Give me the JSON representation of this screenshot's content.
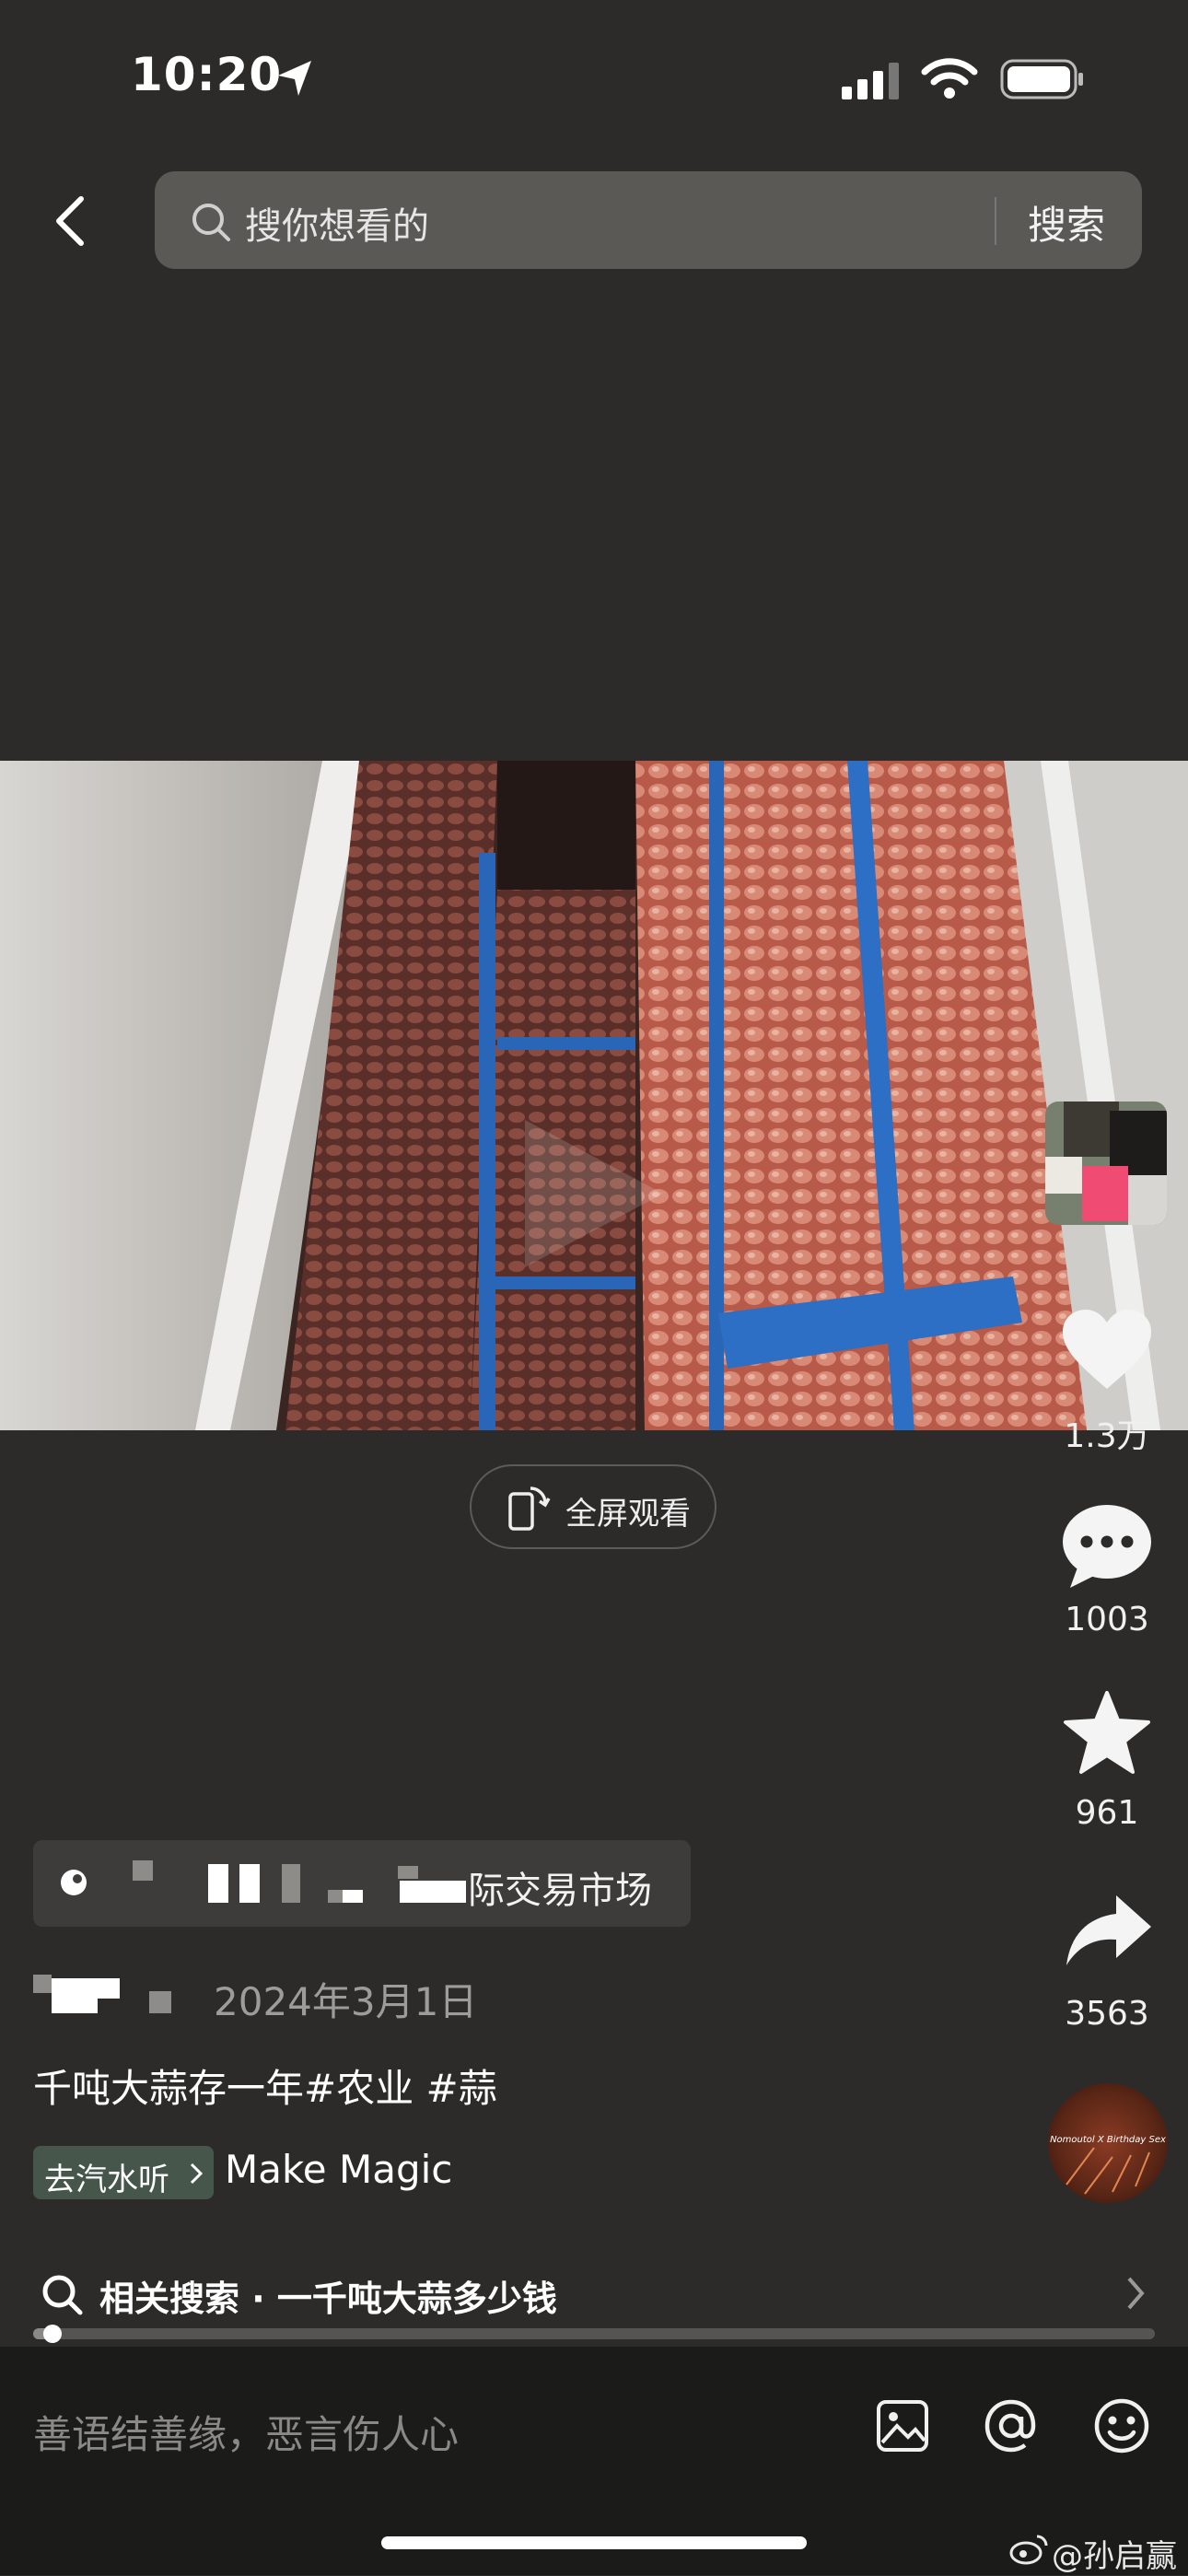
{
  "status_bar": {
    "time": "10:20"
  },
  "search": {
    "placeholder": "搜你想看的",
    "button_label": "搜索"
  },
  "video": {
    "fullscreen_label": "全屏观看"
  },
  "rail": {
    "like_count": "1.3万",
    "comment_count": "1003",
    "favorite_count": "961",
    "share_count": "3563",
    "music_disc_text": "Nomoutol X Birthday Sex"
  },
  "post": {
    "poi_label": "际交易市场",
    "date": "2024年3月1日",
    "caption": "千吨大蒜存一年#农业 #蒜",
    "music_badge": "去汽水听",
    "music_name": "Make Magic"
  },
  "related": {
    "label": "相关搜索 · 一千吨大蒜多少钱"
  },
  "progress": {
    "fraction": 0.017
  },
  "comment_bar": {
    "placeholder": "善语结善缘，恶言伤人心"
  },
  "watermark": {
    "text": "@孙启赢"
  },
  "colors": {
    "background": "#2c2b29",
    "search_bg": "#5a5956",
    "music_badge": "#46564a"
  }
}
